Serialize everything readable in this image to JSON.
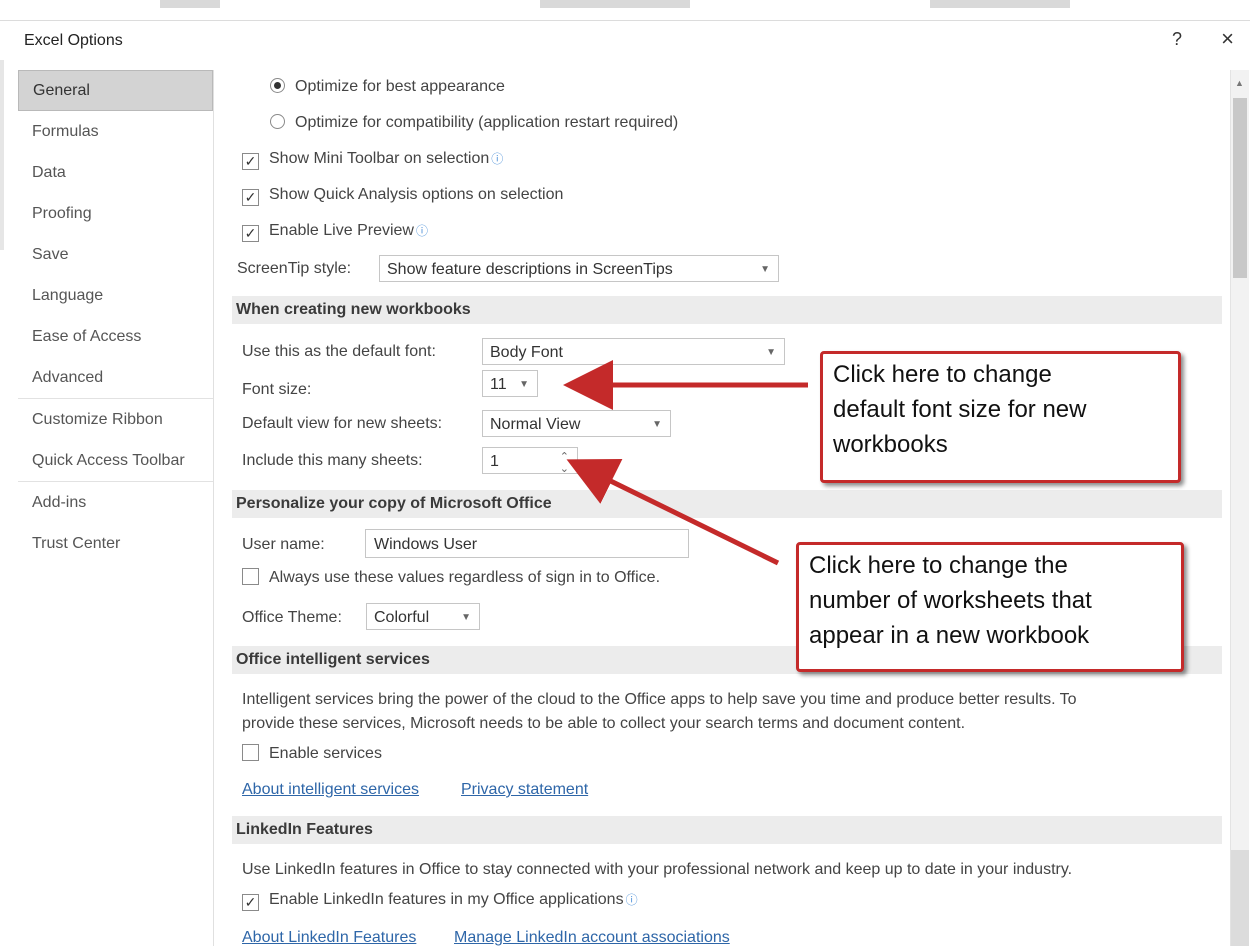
{
  "window": {
    "title": "Excel Options",
    "help_glyph": "?",
    "close_glyph": "×"
  },
  "sidebar": {
    "items": [
      {
        "label": "General"
      },
      {
        "label": "Formulas"
      },
      {
        "label": "Data"
      },
      {
        "label": "Proofing"
      },
      {
        "label": "Save"
      },
      {
        "label": "Language"
      },
      {
        "label": "Ease of Access"
      },
      {
        "label": "Advanced"
      },
      {
        "label": "Customize Ribbon"
      },
      {
        "label": "Quick Access Toolbar"
      },
      {
        "label": "Add-ins"
      },
      {
        "label": "Trust Center"
      }
    ],
    "selected": "General"
  },
  "ui_options": {
    "optimize_appearance": "Optimize for best appearance",
    "optimize_compat": "Optimize for compatibility (application restart required)",
    "mini_toolbar": "Show Mini Toolbar on selection",
    "quick_analysis": "Show Quick Analysis options on selection",
    "live_preview": "Enable Live Preview",
    "screentip_label": "ScreenTip style:",
    "screentip_value": "Show feature descriptions in ScreenTips"
  },
  "new_workbooks": {
    "header": "When creating new workbooks",
    "font_label": "Use this as the default font:",
    "font_value": "Body Font",
    "size_label": "Font size:",
    "size_value": "11",
    "view_label": "Default view for new sheets:",
    "view_value": "Normal View",
    "sheets_label": "Include this many sheets:",
    "sheets_value": "1"
  },
  "personalize": {
    "header": "Personalize your copy of Microsoft Office",
    "username_label": "User name:",
    "username_value": "Windows User",
    "always_use": "Always use these values regardless of sign in to Office.",
    "theme_label": "Office Theme:",
    "theme_value": "Colorful"
  },
  "intelligent": {
    "header": "Office intelligent services",
    "description_line1": "Intelligent services bring the power of the cloud to the Office apps to help save you time and produce better results. To",
    "description_line2": "provide these services, Microsoft needs to be able to collect your search terms and document content.",
    "enable": "Enable services",
    "link_about": "About intelligent services",
    "link_privacy": "Privacy statement"
  },
  "linkedin": {
    "header": "LinkedIn Features",
    "description": "Use LinkedIn features in Office to stay connected with your professional network and keep up to date in your industry.",
    "enable": "Enable LinkedIn features in my Office applications",
    "link_about": "About LinkedIn Features",
    "link_manage": "Manage LinkedIn account associations"
  },
  "annotations": {
    "callout1": [
      "Click here to change",
      "default font size for new",
      "workbooks"
    ],
    "callout2": [
      "Click here to change the",
      "number of worksheets that",
      "appear in a new workbook"
    ],
    "color": "#c42a2a"
  },
  "icons": {
    "info": "info-icon",
    "dropdown": "chevron-down-icon",
    "spinner": "spinner-icon"
  }
}
